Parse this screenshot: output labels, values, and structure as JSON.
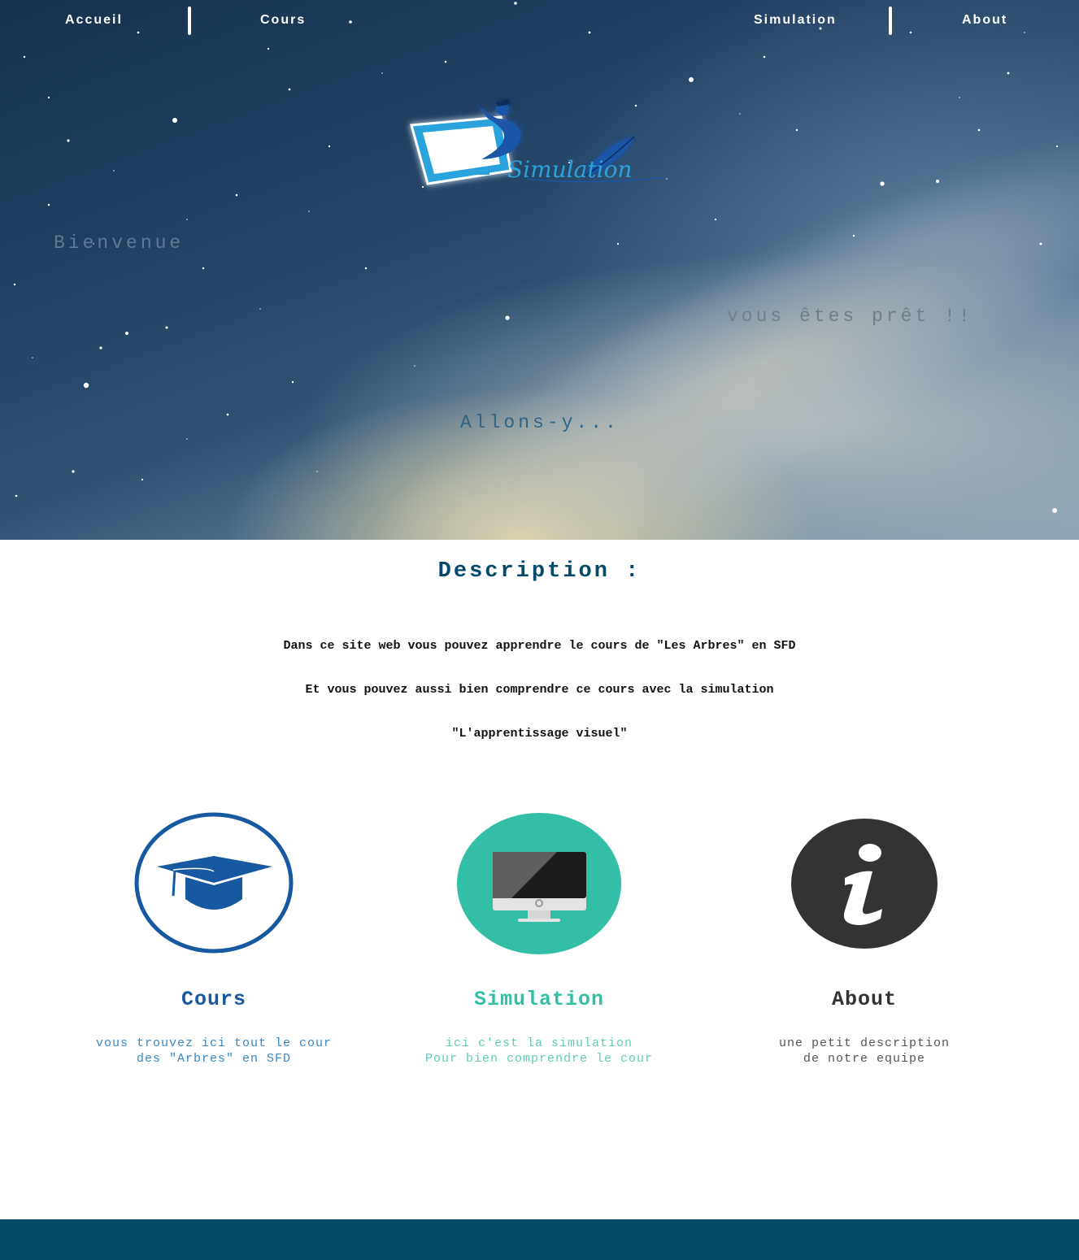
{
  "nav": {
    "items": [
      {
        "label": "Accueil"
      },
      {
        "label": "Cours"
      },
      {
        "label": "Simulation"
      },
      {
        "label": "About"
      }
    ]
  },
  "hero": {
    "logo_word": "Simulation",
    "welcome": "Bienvenue",
    "ready": "vous êtes prêt !!",
    "go": "Allons-y..."
  },
  "description": {
    "title": "Description :",
    "lines": [
      "Dans ce site web vous pouvez apprendre le cours de \"Les Arbres\" en SFD",
      "Et vous pouvez aussi bien comprendre ce cours avec la simulation",
      "\"L'apprentissage visuel\""
    ]
  },
  "features": [
    {
      "title": "Cours",
      "icon": "graduation-cap-icon",
      "color": "#1659a0",
      "text_color": "#3a86c2",
      "lines": [
        "vous trouvez ici tout le cour",
        "des \"Arbres\" en SFD"
      ]
    },
    {
      "title": "Simulation",
      "icon": "monitor-icon",
      "color": "#33bfa6",
      "text_color": "#5fcdb8",
      "lines": [
        "ici c'est la simulation",
        "Pour bien comprendre le cour"
      ]
    },
    {
      "title": "About",
      "icon": "info-icon",
      "color": "#333333",
      "text_color": "#555555",
      "lines": [
        "une petit description",
        "de notre equipe"
      ]
    }
  ],
  "colors": {
    "accent": "#034a6a",
    "footer": "#034a6a"
  }
}
